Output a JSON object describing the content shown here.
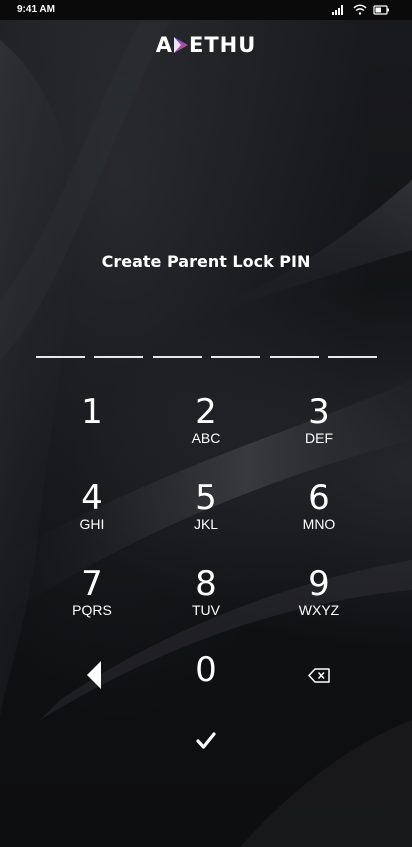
{
  "status_bar": {
    "time": "9:41 AM",
    "icons": [
      "signal-icon",
      "wifi-icon",
      "battery-icon"
    ]
  },
  "brand": {
    "logo_text_before": "A",
    "logo_text_after": "ETHU",
    "logo_mark": "play-triangle-icon",
    "accent_gradient": [
      "#5a4fd6",
      "#e04a8c"
    ]
  },
  "screen": {
    "title": "Create Parent Lock PIN",
    "pin_length": 6,
    "background": "#121315"
  },
  "keypad": {
    "keys": [
      {
        "digit": "1",
        "letters": ""
      },
      {
        "digit": "2",
        "letters": "ABC"
      },
      {
        "digit": "3",
        "letters": "DEF"
      },
      {
        "digit": "4",
        "letters": "GHI"
      },
      {
        "digit": "5",
        "letters": "JKL"
      },
      {
        "digit": "6",
        "letters": "MNO"
      },
      {
        "digit": "7",
        "letters": "PQRS"
      },
      {
        "digit": "8",
        "letters": "TUV"
      },
      {
        "digit": "9",
        "letters": "WXYZ"
      },
      {
        "digit": "0",
        "letters": ""
      }
    ],
    "back_icon": "back-triangle-icon",
    "delete_icon": "backspace-icon",
    "confirm_icon": "checkmark-icon"
  }
}
